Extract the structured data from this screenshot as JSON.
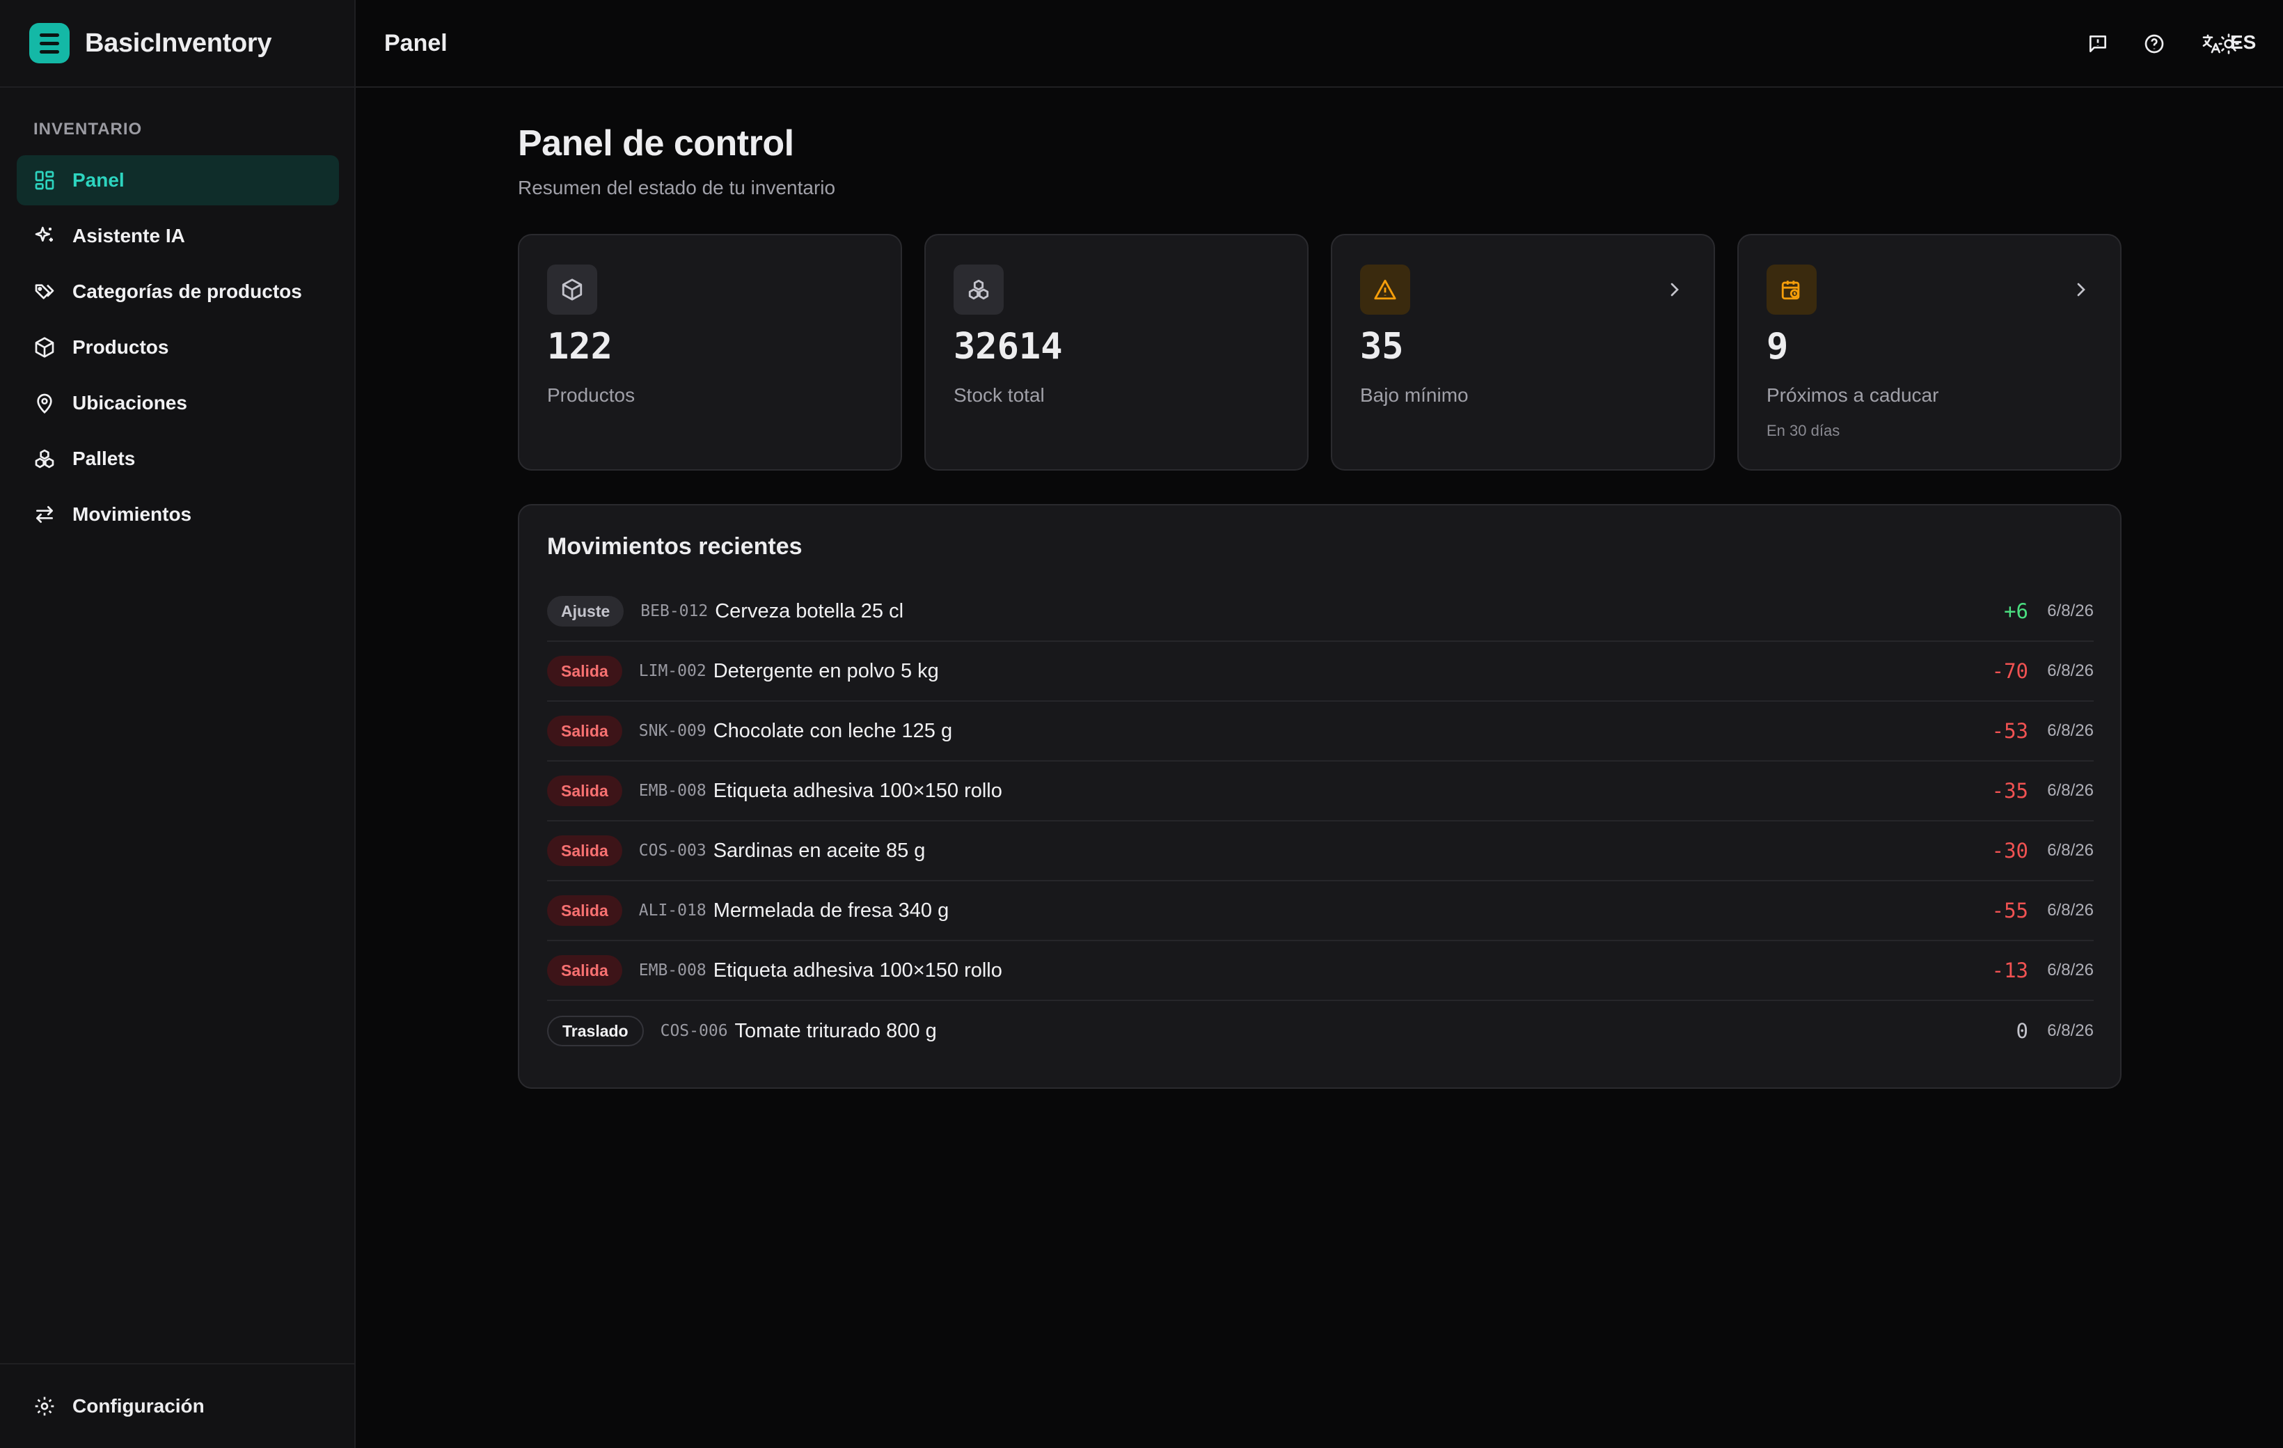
{
  "app": {
    "name": "BasicInventory"
  },
  "sidebar": {
    "section_label": "INVENTARIO",
    "items": [
      {
        "label": "Panel",
        "icon": "dashboard-icon",
        "active": true
      },
      {
        "label": "Asistente IA",
        "icon": "sparkles-icon",
        "active": false
      },
      {
        "label": "Categorías de productos",
        "icon": "tags-icon",
        "active": false
      },
      {
        "label": "Productos",
        "icon": "box-icon",
        "active": false
      },
      {
        "label": "Ubicaciones",
        "icon": "map-pin-icon",
        "active": false
      },
      {
        "label": "Pallets",
        "icon": "boxes-icon",
        "active": false
      },
      {
        "label": "Movimientos",
        "icon": "arrows-icon",
        "active": false
      }
    ],
    "footer": {
      "label": "Configuración",
      "icon": "gear-icon"
    }
  },
  "topbar": {
    "title": "Panel",
    "language": "ES",
    "icons": [
      "feedback-icon",
      "help-icon",
      "translate-icon",
      "sun-icon"
    ]
  },
  "page": {
    "title": "Panel de control",
    "subtitle": "Resumen del estado de tu inventario"
  },
  "stats": [
    {
      "value": "122",
      "label": "Productos",
      "sub": "",
      "icon": "box-icon",
      "has_link": false
    },
    {
      "value": "32614",
      "label": "Stock total",
      "sub": "",
      "icon": "boxes-icon",
      "has_link": false
    },
    {
      "value": "35",
      "label": "Bajo mínimo",
      "sub": "",
      "icon": "warning-icon",
      "has_link": true
    },
    {
      "value": "9",
      "label": "Próximos a caducar",
      "sub": "En 30 días",
      "icon": "calendar-clock-icon",
      "has_link": true
    }
  ],
  "recent_moves": {
    "title": "Movimientos recientes",
    "rows": [
      {
        "type": "Ajuste",
        "kind": "adj",
        "sku": "BEB-012",
        "name": "Cerveza botella 25 cl",
        "qty": "+6",
        "date": "6/8/26"
      },
      {
        "type": "Salida",
        "kind": "out",
        "sku": "LIM-002",
        "name": "Detergente en polvo 5 kg",
        "qty": "-70",
        "date": "6/8/26"
      },
      {
        "type": "Salida",
        "kind": "out",
        "sku": "SNK-009",
        "name": "Chocolate con leche 125 g",
        "qty": "-53",
        "date": "6/8/26"
      },
      {
        "type": "Salida",
        "kind": "out",
        "sku": "EMB-008",
        "name": "Etiqueta adhesiva 100×150 rollo",
        "qty": "-35",
        "date": "6/8/26"
      },
      {
        "type": "Salida",
        "kind": "out",
        "sku": "COS-003",
        "name": "Sardinas en aceite 85 g",
        "qty": "-30",
        "date": "6/8/26"
      },
      {
        "type": "Salida",
        "kind": "out",
        "sku": "ALI-018",
        "name": "Mermelada de fresa 340 g",
        "qty": "-55",
        "date": "6/8/26"
      },
      {
        "type": "Salida",
        "kind": "out",
        "sku": "EMB-008",
        "name": "Etiqueta adhesiva 100×150 rollo",
        "qty": "-13",
        "date": "6/8/26"
      },
      {
        "type": "Traslado",
        "kind": "move",
        "sku": "COS-006",
        "name": "Tomate triturado 800 g",
        "qty": "0",
        "date": "6/8/26"
      }
    ]
  },
  "colors": {
    "accent": "#14b8a6",
    "positive": "#4ade80",
    "negative": "#f05252",
    "warning": "#f59e0b"
  }
}
